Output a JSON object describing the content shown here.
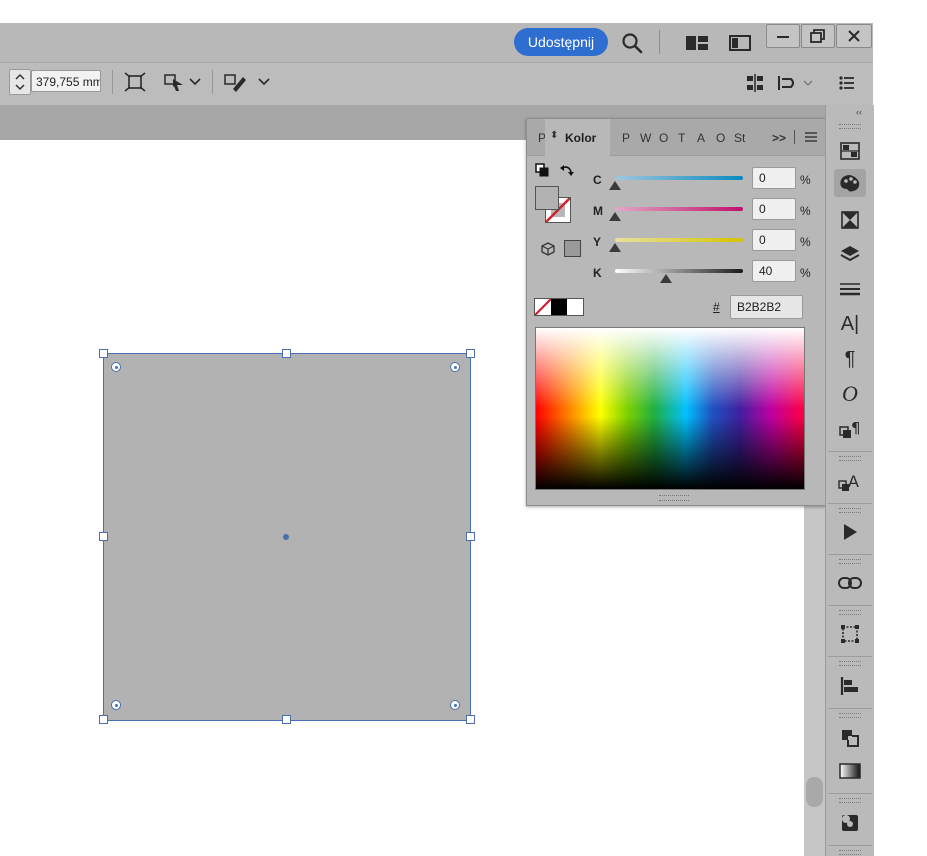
{
  "topbar": {
    "share_label": "Udostępnij",
    "icons": [
      "search-icon",
      "workspace-layout-icon",
      "screen-mode-icon",
      "minimize-icon",
      "restore-icon",
      "close-icon"
    ]
  },
  "controlbar": {
    "width_value": "379,755 mm",
    "icons": [
      "stepper-icon",
      "fit-frame-icon",
      "fit-content-icon",
      "chevron-down-icon",
      "text-wrap-icon",
      "chevron-down-icon",
      "align-icon",
      "quick-apply-icon",
      "panel-menu-icon"
    ]
  },
  "color_panel": {
    "tabs": [
      "P",
      "Kolor",
      "P",
      "W",
      "O",
      "T",
      "A",
      "O",
      "St"
    ],
    "active_tab": "Kolor",
    "overflow_label": ">>",
    "sliders": [
      {
        "label": "C",
        "value": "0",
        "percent": 0,
        "color_start": "#9fc7de",
        "color_end": "#0a8ac0"
      },
      {
        "label": "M",
        "value": "0",
        "percent": 0,
        "color_start": "#e2a9c5",
        "color_end": "#c0106a"
      },
      {
        "label": "Y",
        "value": "0",
        "percent": 0,
        "color_start": "#e6e0a0",
        "color_end": "#d6c400"
      },
      {
        "label": "K",
        "value": "40",
        "percent": 40,
        "color_start": "#ffffff",
        "color_end": "#1a1a1a"
      }
    ],
    "percent_sign": "%",
    "hex_label": "#",
    "hex_value": "B2B2B2",
    "fill_color": "#B2B2B2"
  },
  "dock": {
    "icons": [
      "pages-icon",
      "color-palette-icon",
      "swatches-icon",
      "layers-icon",
      "stroke-icon",
      "character-icon",
      "paragraph-icon",
      "glyphs-icon",
      "paragraph-styles-icon",
      "character-styles-icon",
      "play-icon",
      "links-icon",
      "transform-icon",
      "align-icon",
      "pathfinder-icon",
      "gradient-icon",
      "effects-icon"
    ]
  },
  "canvas": {
    "object_fill": "#B2B2B2",
    "selection_color": "#4a6fb0"
  }
}
